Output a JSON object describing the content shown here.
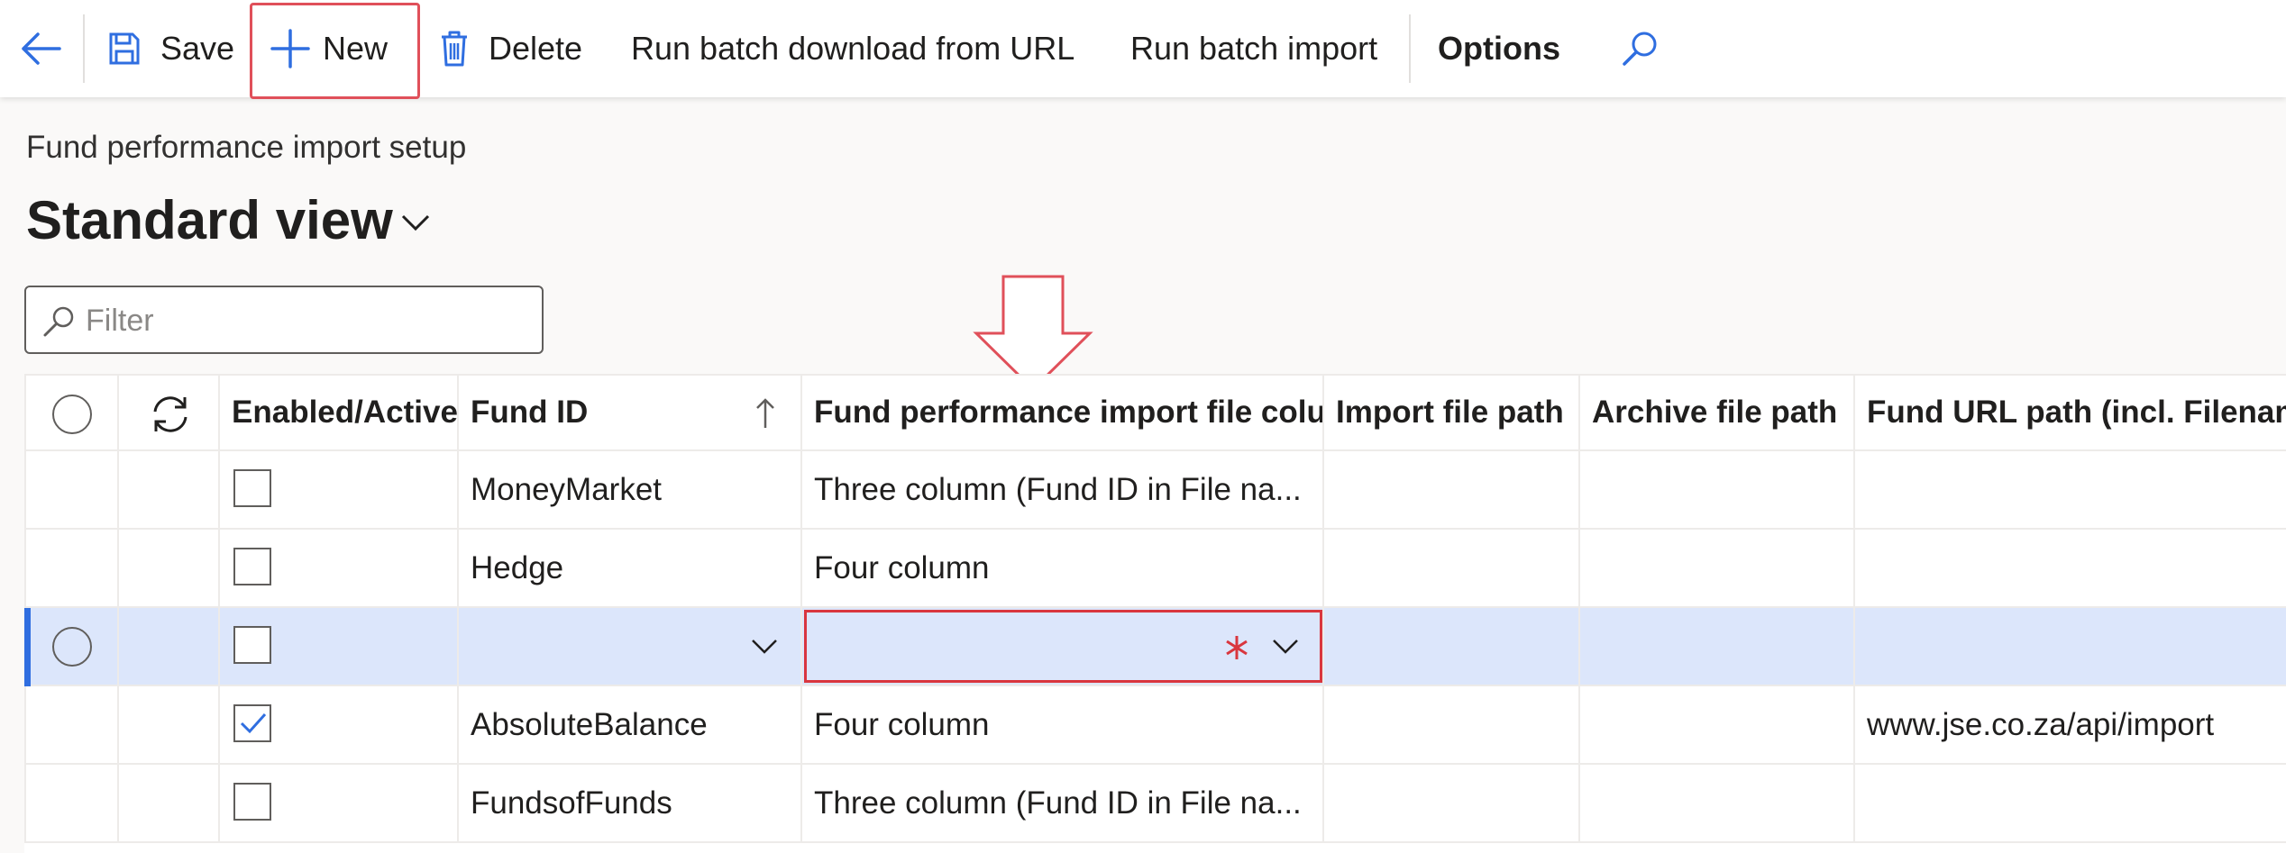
{
  "toolbar": {
    "save_label": "Save",
    "new_label": "New",
    "delete_label": "Delete",
    "batch_download_label": "Run batch download from URL",
    "batch_import_label": "Run batch import",
    "options_label": "Options",
    "accent_color": "#2f6ee0"
  },
  "page": {
    "breadcrumb": "Fund performance import setup",
    "view_title": "Standard view"
  },
  "filter": {
    "placeholder": "Filter"
  },
  "grid": {
    "columns": [
      "Enabled/Active",
      "Fund ID",
      "Fund performance import file colum...",
      "Import file path",
      "Archive file path",
      "Fund URL path (incl. Filename)"
    ],
    "sort": "Fund ID ascending",
    "rows": [
      {
        "enabled": false,
        "fund_id": "MoneyMarket",
        "file_columns": "Three column (Fund ID in File na...",
        "import_path": "",
        "archive_path": "",
        "url_path": ""
      },
      {
        "enabled": false,
        "fund_id": "Hedge",
        "file_columns": "Four column",
        "import_path": "",
        "archive_path": "",
        "url_path": ""
      },
      {
        "enabled": false,
        "fund_id": "",
        "file_columns": "",
        "import_path": "",
        "archive_path": "",
        "url_path": "",
        "selected": true,
        "new_row": true
      },
      {
        "enabled": true,
        "fund_id": "AbsoluteBalance",
        "file_columns": "Four column",
        "import_path": "",
        "archive_path": "",
        "url_path": "www.jse.co.za/api/import"
      },
      {
        "enabled": false,
        "fund_id": "FundsofFunds",
        "file_columns": "Three column (Fund ID in File na...",
        "import_path": "",
        "archive_path": "",
        "url_path": ""
      }
    ]
  },
  "icons": {
    "back": "arrow-left-icon",
    "save": "save-icon",
    "new": "plus-icon",
    "delete": "trash-icon",
    "search": "search-icon",
    "refresh": "refresh-icon",
    "sort": "arrow-up-icon",
    "required": "asterisk-icon"
  },
  "colors": {
    "selection_background": "#dce6fb",
    "required_red": "#d9363e",
    "annotation_red": "#e0505a"
  }
}
